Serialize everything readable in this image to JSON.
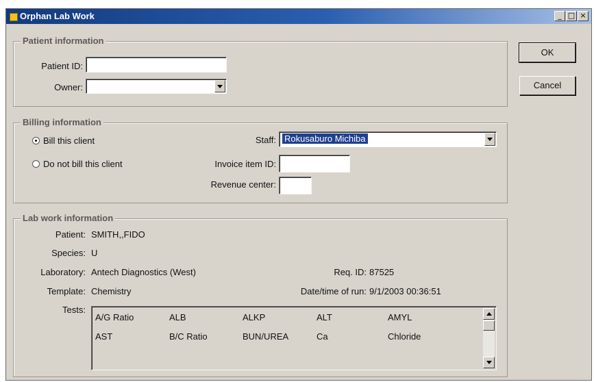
{
  "window": {
    "title": "Orphan Lab Work",
    "minimize_glyph": "_",
    "maximize_glyph": "□",
    "close_glyph": "×",
    "titlebar_color": "#123a7e"
  },
  "buttons": {
    "ok": "OK",
    "cancel": "Cancel"
  },
  "patient_info": {
    "legend": "Patient information",
    "patient_id_label": "Patient ID:",
    "patient_id_value": "",
    "owner_label": "Owner:",
    "owner_value": ""
  },
  "billing_info": {
    "legend": "Billing information",
    "bill_client_label": "Bill this client",
    "no_bill_label": "Do not bill this client",
    "selected_option": "Bill this client",
    "staff_label": "Staff:",
    "staff_value": "Rokusaburo Michiba",
    "invoice_item_label": "Invoice item ID:",
    "invoice_item_value": "",
    "revenue_center_label": "Revenue center:",
    "revenue_center_value": ""
  },
  "lab_work": {
    "legend": "Lab work information",
    "patient_label": "Patient:",
    "patient_value": "SMITH,,FIDO",
    "species_label": "Species:",
    "species_value": "U",
    "laboratory_label": "Laboratory:",
    "laboratory_value": "Antech Diagnostics (West)",
    "req_id_label": "Req. ID:",
    "req_id_value": "87525",
    "template_label": "Template:",
    "template_value": "Chemistry",
    "datetime_label": "Date/time of run:",
    "datetime_value": "9/1/2003 00:36:51",
    "tests_label": "Tests:",
    "tests": [
      [
        "A/G Ratio",
        "ALB",
        "ALKP",
        "ALT",
        "AMYL"
      ],
      [
        "AST",
        "B/C Ratio",
        "BUN/UREA",
        "Ca",
        "Chloride"
      ]
    ]
  }
}
